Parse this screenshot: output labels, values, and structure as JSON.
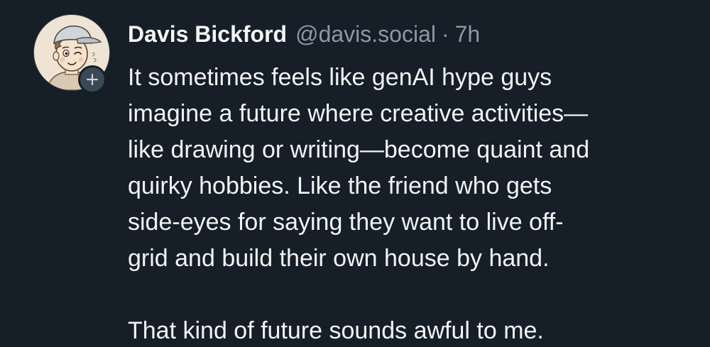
{
  "post": {
    "author": {
      "display_name": "Davis Bickford",
      "handle": "@davis.social",
      "avatar_icon": "cartoon-avatar-icon",
      "follow_icon": "plus-icon"
    },
    "separator": "·",
    "time": "7h",
    "text_lines": [
      "It sometimes feels like genAI hype guys",
      "imagine a future where creative activities—",
      "like drawing or writing—become quaint and",
      "quirky hobbies. Like the friend who gets",
      "side-eyes for saying they want to live off-",
      "grid and build their own house by hand.",
      "",
      "That kind of future sounds awful to me."
    ]
  },
  "colors": {
    "background": "#161e27",
    "text": "#f1f3f5",
    "muted": "#8b98a8",
    "badge": "#3b4856"
  }
}
